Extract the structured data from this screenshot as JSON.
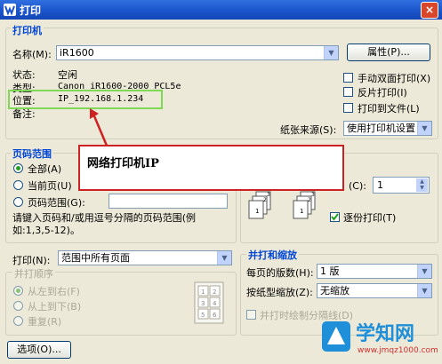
{
  "window": {
    "title": "打印",
    "close_glyph": "×"
  },
  "printer": {
    "group_title": "打印机",
    "name_label": "名称(M):",
    "name_value": "iR1600",
    "properties_button": "属性(P)...",
    "status_label": "状态:",
    "status_value": "空闲",
    "type_label": "类型:",
    "type_value": "Canon iR1600-2000 PCL5e",
    "location_label": "位置:",
    "location_value": "IP_192.168.1.234",
    "comment_label": "备注:",
    "duplex_label": "手动双面打印(X)",
    "reverse_label": "反片打印(I)",
    "print_to_file_label": "打印到文件(L)",
    "paper_source_label": "纸张来源(S):",
    "paper_source_value": "使用打印机设置"
  },
  "callout": {
    "text": "网络打印机IP",
    "accent": "#cc2222"
  },
  "page_range": {
    "group_title": "页码范围",
    "all_label": "全部(A)",
    "current_label": "当前页(U)",
    "range_label": "页码范围(G):",
    "hint": "请键入页码和/或用逗号分隔的页码范围(例如:1,3,5-12)。"
  },
  "copies": {
    "label_suffix": "(C):",
    "value": "1",
    "collate_label": "逐份打印(T)"
  },
  "print_what": {
    "label": "打印(N):",
    "value": "范围中所有页面"
  },
  "order": {
    "group_title": "并打顺序",
    "ltr": "从左到右(F)",
    "ttb": "从上到下(B)",
    "repeat": "重复(R)"
  },
  "zoom": {
    "group_title": "并打和缩放",
    "per_sheet_label": "每页的版数(H):",
    "per_sheet_value": "1 版",
    "scale_label": "按纸型缩放(Z):",
    "scale_value": "无缩放",
    "draw_border_label": "并打时绘制分隔线(D)"
  },
  "options_button": "选项(O)...",
  "watermark": {
    "text": "学知网",
    "url": "www.jmqz1000.com"
  }
}
